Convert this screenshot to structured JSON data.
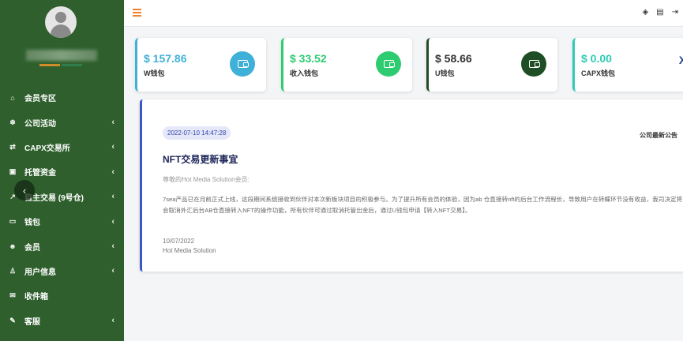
{
  "sidebar": {
    "colors": {
      "bar1": "#d08b2a",
      "bar2": "#2f7d4a"
    },
    "items": [
      {
        "icon": "home-icon",
        "glyph": "⌂",
        "label": "会员专区",
        "has_chevron": false
      },
      {
        "icon": "snowflake-icon",
        "glyph": "❄",
        "label": "公司活动",
        "has_chevron": true
      },
      {
        "icon": "exchange-icon",
        "glyph": "⇄",
        "label": "CAPX交易所",
        "has_chevron": true
      },
      {
        "icon": "safe-icon",
        "glyph": "▣",
        "label": "托管资金",
        "has_chevron": true
      },
      {
        "icon": "chart-icon",
        "glyph": "↗",
        "label": "自主交易 (9号仓)",
        "has_chevron": true
      },
      {
        "icon": "wallet-icon",
        "glyph": "▭",
        "label": "钱包",
        "has_chevron": true
      },
      {
        "icon": "users-icon",
        "glyph": "☻",
        "label": "会员",
        "has_chevron": true
      },
      {
        "icon": "user-icon",
        "glyph": "♙",
        "label": "用户信息",
        "has_chevron": true
      },
      {
        "icon": "inbox-icon",
        "glyph": "✉",
        "label": "收件箱",
        "has_chevron": false
      },
      {
        "icon": "support-icon",
        "glyph": "✎",
        "label": "客服",
        "has_chevron": true
      }
    ]
  },
  "cards": [
    {
      "amount": "$ 157.86",
      "label": "W钱包",
      "color": "#3fb0d8"
    },
    {
      "amount": "$ 33.52",
      "label": "收入钱包",
      "color": "#2ecc71"
    },
    {
      "amount": "$ 58.66",
      "label": "U钱包",
      "color": "#1e4d26",
      "amount_color": "#333333"
    },
    {
      "amount": "$ 0.00",
      "label": "CAPX钱包",
      "color": "#2ecbb5",
      "logo": "X",
      "logo_suffix": "ca"
    }
  ],
  "announcement": {
    "date": "2022-07-10 14:47:28",
    "tag": "公司最新公告",
    "title": "NFT交易更新事宜",
    "greeting": "尊敬的Hot Media Solution会员:",
    "body": "7sea产品已在月前正式上线，这段期间系统接收到伙伴对本次新板块项目的积极参与。为了提升所有会员的体验，因为ab 仓直接转nft的后台工作流程长，导致用户在转蝶环节没有收益，我司决定将会取消外汇后台AB仓直接转入NFT的操作功能，所有伙伴可通过取消托管出金后，通过U钱包申请【转入NFT交易】。",
    "sign_date": "10/07/2022",
    "sign_name": "Hot Media Solution"
  }
}
